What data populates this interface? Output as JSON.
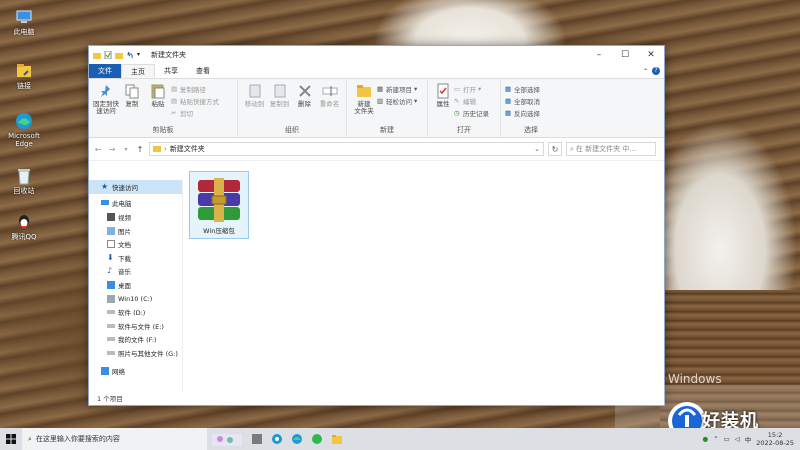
{
  "desktop_icons": [
    {
      "label": "此电脑",
      "icon": "computer-icon"
    },
    {
      "label": "链接",
      "icon": "shortcut-icon"
    },
    {
      "label": "Microsoft Edge",
      "icon": "edge-icon"
    },
    {
      "label": "回收站",
      "icon": "recycle-bin-icon"
    },
    {
      "label": "腾讯QQ",
      "icon": "qq-icon"
    }
  ],
  "window": {
    "title": "新建文件夹",
    "tabs": {
      "file": "文件",
      "home": "主页",
      "share": "共享",
      "view": "查看"
    },
    "ribbon": {
      "clipboard": {
        "pin": "固定到快\n速访问",
        "copy": "复制",
        "paste": "粘贴",
        "copy_path": "复制路径",
        "paste_shortcut": "粘贴快捷方式",
        "cut": "剪切",
        "label": "剪贴板"
      },
      "organize": {
        "move_to": "移动到",
        "copy_to": "复制到",
        "delete": "删除",
        "rename": "重命名",
        "label": "组织"
      },
      "new": {
        "new_folder": "新建\n文件夹",
        "new_item": "新建项目",
        "easy_access": "轻松访问",
        "label": "新建"
      },
      "open": {
        "properties": "属性",
        "open": "打开",
        "edit": "编辑",
        "history": "历史记录",
        "label": "打开"
      },
      "select": {
        "select_all": "全部选择",
        "select_none": "全部取消",
        "invert": "反向选择",
        "label": "选择"
      }
    },
    "address": {
      "path": "新建文件夹",
      "search_placeholder": "在 新建文件夹 中..."
    },
    "nav": {
      "quick_access": "快速访问",
      "this_pc": "此电脑",
      "items": [
        "视频",
        "图片",
        "文档",
        "下载",
        "音乐",
        "桌面"
      ],
      "drives": [
        "Win10 (C:)",
        "软件 (D:)",
        "软件与文件 (E:)",
        "我的文件 (F:)",
        "照片与其他文件 (G:)"
      ],
      "network": "网络"
    },
    "files": [
      {
        "name": "Win压缩包",
        "icon": "winrar-archive-icon"
      }
    ],
    "status": "1 个项目"
  },
  "taskbar": {
    "search_placeholder": "在这里输入你要搜索的内容",
    "time": "15:2",
    "date": "2022-08-25"
  },
  "watermark": {
    "text": "好装机",
    "windows_text": "Windows"
  },
  "colors": {
    "accent": "#1a5fb4",
    "selection": "#cce4f7",
    "file_hover": "#e5f3fb"
  }
}
